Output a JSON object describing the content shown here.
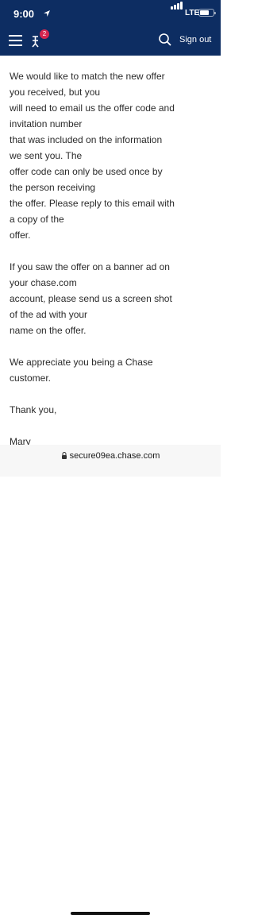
{
  "status_bar": {
    "time": "9:00",
    "network": "LTE"
  },
  "header": {
    "notification_count": "2",
    "sign_out_label": "Sign out"
  },
  "message": {
    "paragraph1": [
      "We would like to match the new offer",
      "you received, but you",
      "will need to email us the offer code and",
      "invitation number",
      "that was included on the information",
      "we sent you. The",
      "offer code can only be used once by",
      "the person receiving",
      "the offer. Please reply to this email with",
      "a copy of the",
      "offer."
    ],
    "paragraph2": [
      "If you saw the offer on a banner ad on",
      "your chase.com",
      "account, please send us a screen shot",
      "of the ad with your",
      "name on the offer."
    ],
    "paragraph3": [
      "We appreciate you being a Chase",
      "customer."
    ],
    "closing": "Thank you,",
    "signature": "Mary"
  },
  "browser": {
    "url": "secure09ea.chase.com"
  },
  "colors": {
    "header_bg": "#0d2d62",
    "badge": "#d5264f",
    "text": "#2b2b2b"
  }
}
